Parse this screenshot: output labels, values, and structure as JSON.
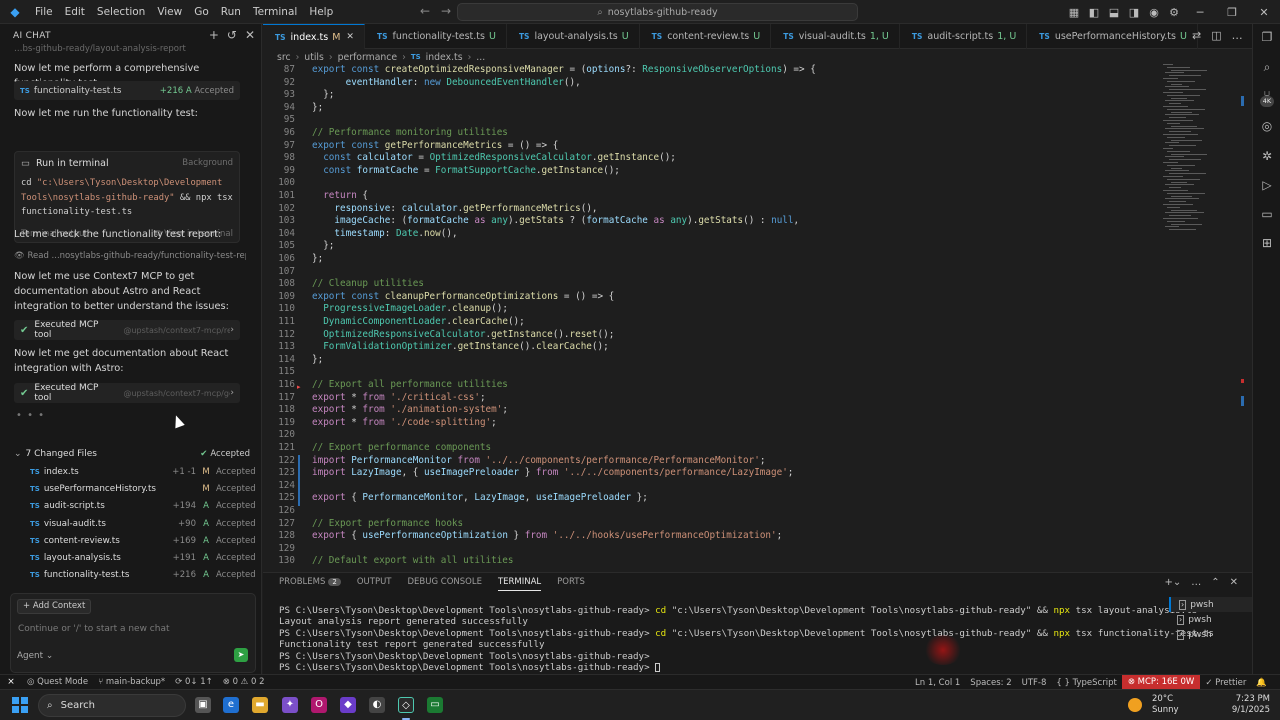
{
  "titlebar": {
    "menu": [
      "File",
      "Edit",
      "Selection",
      "View",
      "Go",
      "Run",
      "Terminal",
      "Help"
    ],
    "search": "nosytlabs-github-ready"
  },
  "chat": {
    "header": "AI CHAT",
    "truncated_top": "…bs-github-ready/layout-analysis-report",
    "msg1": "Now let me perform a comprehensive functionality test:",
    "chip1": {
      "name": "functionality-test.ts",
      "plus": "+216",
      "flag": "A",
      "status": "Accepted"
    },
    "msg2": "Now let me run the functionality test:",
    "terminal_card": {
      "title": "Run in terminal",
      "badge": "Background",
      "cmd_prefix": "cd ",
      "cmd_str1": "\"c:\\Users\\Tyson\\Desktop\\Development",
      "cmd_str2": "Tools\\nosytlabs-github-ready\"",
      "cmd_rest": " && npx tsx",
      "cmd_line3": "functionality-test.ts",
      "output": "Terminal output",
      "view": "View in terminal"
    },
    "msg3": "Let me check the functionality test report:",
    "read": "Read ...nosytlabs-github-ready/functionality-test-report.md",
    "msg4": "Now let me use Context7 MCP to get documentation about Astro and React integration to better understand the issues:",
    "mcp1": {
      "label": "Executed MCP tool",
      "sub": "@upstash/context7-mcp/reso..."
    },
    "msg5": "Now let me get documentation about React integration with Astro:",
    "mcp2": {
      "label": "Executed MCP tool",
      "sub": "@upstash/context7-mcp/get-l..."
    },
    "changed_files": {
      "title": "7 Changed Files",
      "accepted": "Accepted",
      "files": [
        {
          "name": "index.ts",
          "stat": "+1 -1",
          "flag": "M",
          "status": "Accepted"
        },
        {
          "name": "usePerformanceHistory.ts",
          "stat": "",
          "flag": "M",
          "status": "Accepted"
        },
        {
          "name": "audit-script.ts",
          "stat": "+194",
          "flag": "A",
          "status": "Accepted"
        },
        {
          "name": "visual-audit.ts",
          "stat": "+90",
          "flag": "A",
          "status": "Accepted"
        },
        {
          "name": "content-review.ts",
          "stat": "+169",
          "flag": "A",
          "status": "Accepted"
        },
        {
          "name": "layout-analysis.ts",
          "stat": "+191",
          "flag": "A",
          "status": "Accepted"
        },
        {
          "name": "functionality-test.ts",
          "stat": "+216",
          "flag": "A",
          "status": "Accepted"
        }
      ]
    },
    "input": {
      "add_context": "+ Add Context",
      "placeholder": "Continue or '/' to start a new chat",
      "mode": "Agent ⌄"
    }
  },
  "tabs": [
    {
      "name": "index.ts",
      "suffix": "M",
      "kind": "mod",
      "active": true
    },
    {
      "name": "functionality-test.ts",
      "suffix": "U",
      "kind": "untr"
    },
    {
      "name": "layout-analysis.ts",
      "suffix": "U",
      "kind": "untr"
    },
    {
      "name": "content-review.ts",
      "suffix": "U",
      "kind": "untr"
    },
    {
      "name": "visual-audit.ts",
      "suffix": "1, U",
      "kind": "untr"
    },
    {
      "name": "audit-script.ts",
      "suffix": "1, U",
      "kind": "untr"
    },
    {
      "name": "usePerformanceHistory.ts",
      "suffix": "U",
      "kind": "untr"
    }
  ],
  "breadcrumb": [
    "src",
    "utils",
    "performance",
    "index.ts",
    "..."
  ],
  "code": [
    {
      "n": "87",
      "t": [
        [
          "kw",
          "export "
        ],
        [
          "kw",
          "const "
        ],
        [
          "fn",
          "createOptimizedResponsiveManager"
        ],
        [
          "code",
          " = ("
        ],
        [
          "var",
          "options"
        ],
        [
          "code",
          "?: "
        ],
        [
          "ty",
          "ResponsiveObserverOptions"
        ],
        [
          "code",
          ") => {"
        ]
      ]
    },
    {
      "n": "92",
      "t": [
        [
          "code",
          "      "
        ],
        [
          "var",
          "eventHandler"
        ],
        [
          "code",
          ": "
        ],
        [
          "kw",
          "new "
        ],
        [
          "ty",
          "DebouncedEventHandler"
        ],
        [
          "code",
          "(),"
        ]
      ]
    },
    {
      "n": "93",
      "t": [
        [
          "code",
          "  };"
        ]
      ]
    },
    {
      "n": "94",
      "t": [
        [
          "code",
          "};"
        ]
      ]
    },
    {
      "n": "95",
      "t": [
        [
          "code",
          ""
        ]
      ]
    },
    {
      "n": "96",
      "t": [
        [
          "cm",
          "// Performance monitoring utilities"
        ]
      ]
    },
    {
      "n": "97",
      "t": [
        [
          "kw",
          "export "
        ],
        [
          "kw",
          "const "
        ],
        [
          "fn",
          "getPerformanceMetrics"
        ],
        [
          "code",
          " = () => {"
        ]
      ]
    },
    {
      "n": "98",
      "t": [
        [
          "code",
          "  "
        ],
        [
          "kw",
          "const "
        ],
        [
          "var",
          "calculator"
        ],
        [
          "code",
          " = "
        ],
        [
          "ty",
          "OptimizedResponsiveCalculator"
        ],
        [
          "code",
          "."
        ],
        [
          "fn",
          "getInstance"
        ],
        [
          "code",
          "();"
        ]
      ]
    },
    {
      "n": "99",
      "t": [
        [
          "code",
          "  "
        ],
        [
          "kw",
          "const "
        ],
        [
          "var",
          "formatCache"
        ],
        [
          "code",
          " = "
        ],
        [
          "ty",
          "FormatSupportCache"
        ],
        [
          "code",
          "."
        ],
        [
          "fn",
          "getInstance"
        ],
        [
          "code",
          "();"
        ]
      ]
    },
    {
      "n": "100",
      "t": [
        [
          "code",
          ""
        ]
      ]
    },
    {
      "n": "101",
      "t": [
        [
          "code",
          "  "
        ],
        [
          "kw2",
          "return "
        ],
        [
          "code",
          "{"
        ]
      ]
    },
    {
      "n": "102",
      "t": [
        [
          "code",
          "    "
        ],
        [
          "var",
          "responsive"
        ],
        [
          "code",
          ": "
        ],
        [
          "var",
          "calculator"
        ],
        [
          "code",
          "."
        ],
        [
          "fn",
          "getPerformanceMetrics"
        ],
        [
          "code",
          "(),"
        ]
      ]
    },
    {
      "n": "103",
      "t": [
        [
          "code",
          "    "
        ],
        [
          "var",
          "imageCache"
        ],
        [
          "code",
          ": ("
        ],
        [
          "var",
          "formatCache"
        ],
        [
          "code",
          " "
        ],
        [
          "kw2",
          "as "
        ],
        [
          "ty",
          "any"
        ],
        [
          "code",
          ")."
        ],
        [
          "fn",
          "getStats"
        ],
        [
          "code",
          " ? ("
        ],
        [
          "var",
          "formatCache"
        ],
        [
          "code",
          " "
        ],
        [
          "kw2",
          "as "
        ],
        [
          "ty",
          "any"
        ],
        [
          "code",
          ")."
        ],
        [
          "fn",
          "getStats"
        ],
        [
          "code",
          "() : "
        ],
        [
          "kw",
          "null"
        ],
        [
          "code",
          ","
        ]
      ]
    },
    {
      "n": "104",
      "t": [
        [
          "code",
          "    "
        ],
        [
          "var",
          "timestamp"
        ],
        [
          "code",
          ": "
        ],
        [
          "ty",
          "Date"
        ],
        [
          "code",
          "."
        ],
        [
          "fn",
          "now"
        ],
        [
          "code",
          "(),"
        ]
      ]
    },
    {
      "n": "105",
      "t": [
        [
          "code",
          "  };"
        ]
      ]
    },
    {
      "n": "106",
      "t": [
        [
          "code",
          "};"
        ]
      ]
    },
    {
      "n": "107",
      "t": [
        [
          "code",
          ""
        ]
      ]
    },
    {
      "n": "108",
      "t": [
        [
          "cm",
          "// Cleanup utilities"
        ]
      ]
    },
    {
      "n": "109",
      "t": [
        [
          "kw",
          "export "
        ],
        [
          "kw",
          "const "
        ],
        [
          "fn",
          "cleanupPerformanceOptimizations"
        ],
        [
          "code",
          " = () => {"
        ]
      ]
    },
    {
      "n": "110",
      "t": [
        [
          "code",
          "  "
        ],
        [
          "ty",
          "ProgressiveImageLoader"
        ],
        [
          "code",
          "."
        ],
        [
          "fn",
          "cleanup"
        ],
        [
          "code",
          "();"
        ]
      ]
    },
    {
      "n": "111",
      "t": [
        [
          "code",
          "  "
        ],
        [
          "ty",
          "DynamicComponentLoader"
        ],
        [
          "code",
          "."
        ],
        [
          "fn",
          "clearCache"
        ],
        [
          "code",
          "();"
        ]
      ]
    },
    {
      "n": "112",
      "t": [
        [
          "code",
          "  "
        ],
        [
          "ty",
          "OptimizedResponsiveCalculator"
        ],
        [
          "code",
          "."
        ],
        [
          "fn",
          "getInstance"
        ],
        [
          "code",
          "()."
        ],
        [
          "fn",
          "reset"
        ],
        [
          "code",
          "();"
        ]
      ]
    },
    {
      "n": "113",
      "t": [
        [
          "code",
          "  "
        ],
        [
          "ty",
          "FormValidationOptimizer"
        ],
        [
          "code",
          "."
        ],
        [
          "fn",
          "getInstance"
        ],
        [
          "code",
          "()."
        ],
        [
          "fn",
          "clearCache"
        ],
        [
          "code",
          "();"
        ]
      ]
    },
    {
      "n": "114",
      "t": [
        [
          "code",
          "};"
        ]
      ]
    },
    {
      "n": "115",
      "t": [
        [
          "code",
          ""
        ]
      ]
    },
    {
      "n": "116",
      "t": [
        [
          "cm",
          "// Export all performance utilities"
        ]
      ]
    },
    {
      "n": "117",
      "t": [
        [
          "kw2",
          "export "
        ],
        [
          "code",
          "* "
        ],
        [
          "kw2",
          "from "
        ],
        [
          "str",
          "'./critical-css'"
        ],
        [
          "code",
          ";"
        ]
      ]
    },
    {
      "n": "118",
      "t": [
        [
          "kw2",
          "export "
        ],
        [
          "code",
          "* "
        ],
        [
          "kw2",
          "from "
        ],
        [
          "str",
          "'./animation-system'"
        ],
        [
          "code",
          ";"
        ]
      ]
    },
    {
      "n": "119",
      "t": [
        [
          "kw2",
          "export "
        ],
        [
          "code",
          "* "
        ],
        [
          "kw2",
          "from "
        ],
        [
          "str",
          "'./code-splitting'"
        ],
        [
          "code",
          ";"
        ]
      ]
    },
    {
      "n": "120",
      "t": [
        [
          "code",
          ""
        ]
      ]
    },
    {
      "n": "121",
      "t": [
        [
          "cm",
          "// Export performance components"
        ]
      ]
    },
    {
      "n": "122",
      "t": [
        [
          "kw2",
          "import "
        ],
        [
          "var",
          "PerformanceMonitor"
        ],
        [
          "code",
          " "
        ],
        [
          "kw2",
          "from "
        ],
        [
          "str",
          "'../../components/performance/PerformanceMonitor'"
        ],
        [
          "code",
          ";"
        ]
      ]
    },
    {
      "n": "123",
      "t": [
        [
          "kw2",
          "import "
        ],
        [
          "var",
          "LazyImage"
        ],
        [
          "code",
          ", { "
        ],
        [
          "var",
          "useImagePreloader"
        ],
        [
          "code",
          " } "
        ],
        [
          "kw2",
          "from "
        ],
        [
          "str",
          "'../../components/performance/LazyImage'"
        ],
        [
          "code",
          ";"
        ]
      ]
    },
    {
      "n": "124",
      "t": [
        [
          "code",
          ""
        ]
      ]
    },
    {
      "n": "125",
      "t": [
        [
          "kw2",
          "export "
        ],
        [
          "code",
          "{ "
        ],
        [
          "var",
          "PerformanceMonitor"
        ],
        [
          "code",
          ", "
        ],
        [
          "var",
          "LazyImage"
        ],
        [
          "code",
          ", "
        ],
        [
          "var",
          "useImagePreloader"
        ],
        [
          "code",
          " };"
        ]
      ]
    },
    {
      "n": "126",
      "t": [
        [
          "code",
          ""
        ]
      ]
    },
    {
      "n": "127",
      "t": [
        [
          "cm",
          "// Export performance hooks"
        ]
      ]
    },
    {
      "n": "128",
      "t": [
        [
          "kw2",
          "export "
        ],
        [
          "code",
          "{ "
        ],
        [
          "var",
          "usePerformanceOptimization"
        ],
        [
          "code",
          " } "
        ],
        [
          "kw2",
          "from "
        ],
        [
          "str",
          "'../../hooks/usePerformanceOptimization'"
        ],
        [
          "code",
          ";"
        ]
      ]
    },
    {
      "n": "129",
      "t": [
        [
          "code",
          ""
        ]
      ]
    },
    {
      "n": "130",
      "t": [
        [
          "cm",
          "// Default export with all utilities"
        ]
      ]
    }
  ],
  "panel": {
    "tabs": [
      "PROBLEMS",
      "OUTPUT",
      "DEBUG CONSOLE",
      "TERMINAL",
      "PORTS"
    ],
    "problems_count": "2",
    "active": "TERMINAL",
    "terminal": [
      {
        "prompt": "PS C:\\Users\\Tyson\\Desktop\\Development Tools\\nosytlabs-github-ready> ",
        "cmd": "cd",
        "arg": " \"c:\\Users\\Tyson\\Desktop\\Development Tools\\nosytlabs-github-ready\"",
        "rest": " && ",
        "npx": "npx",
        "tail": " tsx layout-analysis.ts"
      },
      {
        "plain": "Layout analysis report generated successfully"
      },
      {
        "prompt": "PS C:\\Users\\Tyson\\Desktop\\Development Tools\\nosytlabs-github-ready> ",
        "cmd": "cd",
        "arg": " \"c:\\Users\\Tyson\\Desktop\\Development Tools\\nosytlabs-github-ready\"",
        "rest": " && ",
        "npx": "npx",
        "tail": " tsx functionality-test.ts"
      },
      {
        "plain": "Functionality test report generated successfully"
      },
      {
        "prompt": "PS C:\\Users\\Tyson\\Desktop\\Development Tools\\nosytlabs-github-ready> "
      },
      {
        "prompt": "PS C:\\Users\\Tyson\\Desktop\\Development Tools\\nosytlabs-github-ready> ",
        "cursor": true
      }
    ],
    "terminal_list": [
      "pwsh",
      "pwsh",
      "pwsh"
    ]
  },
  "statusbar": {
    "quest": "Quest Mode",
    "branch": "main-backup*",
    "sync": "0↓ 1↑",
    "problems": "⊗ 0 ⚠ 0 2",
    "position": "Ln 1, Col 1",
    "spaces": "Spaces: 2",
    "encoding": "UTF-8",
    "language": "TypeScript",
    "mcp": "MCP: 16E 0W",
    "prettier": "Prettier"
  },
  "taskbar": {
    "search": "Search",
    "weather_temp": "20°C",
    "weather_desc": "Sunny",
    "time": "7:23 PM",
    "date": "9/1/2025"
  },
  "colors": {
    "accent": "#0078d4",
    "mcp_error": "#c72e2e",
    "added": "#73c991",
    "modified": "#e2c08d"
  }
}
